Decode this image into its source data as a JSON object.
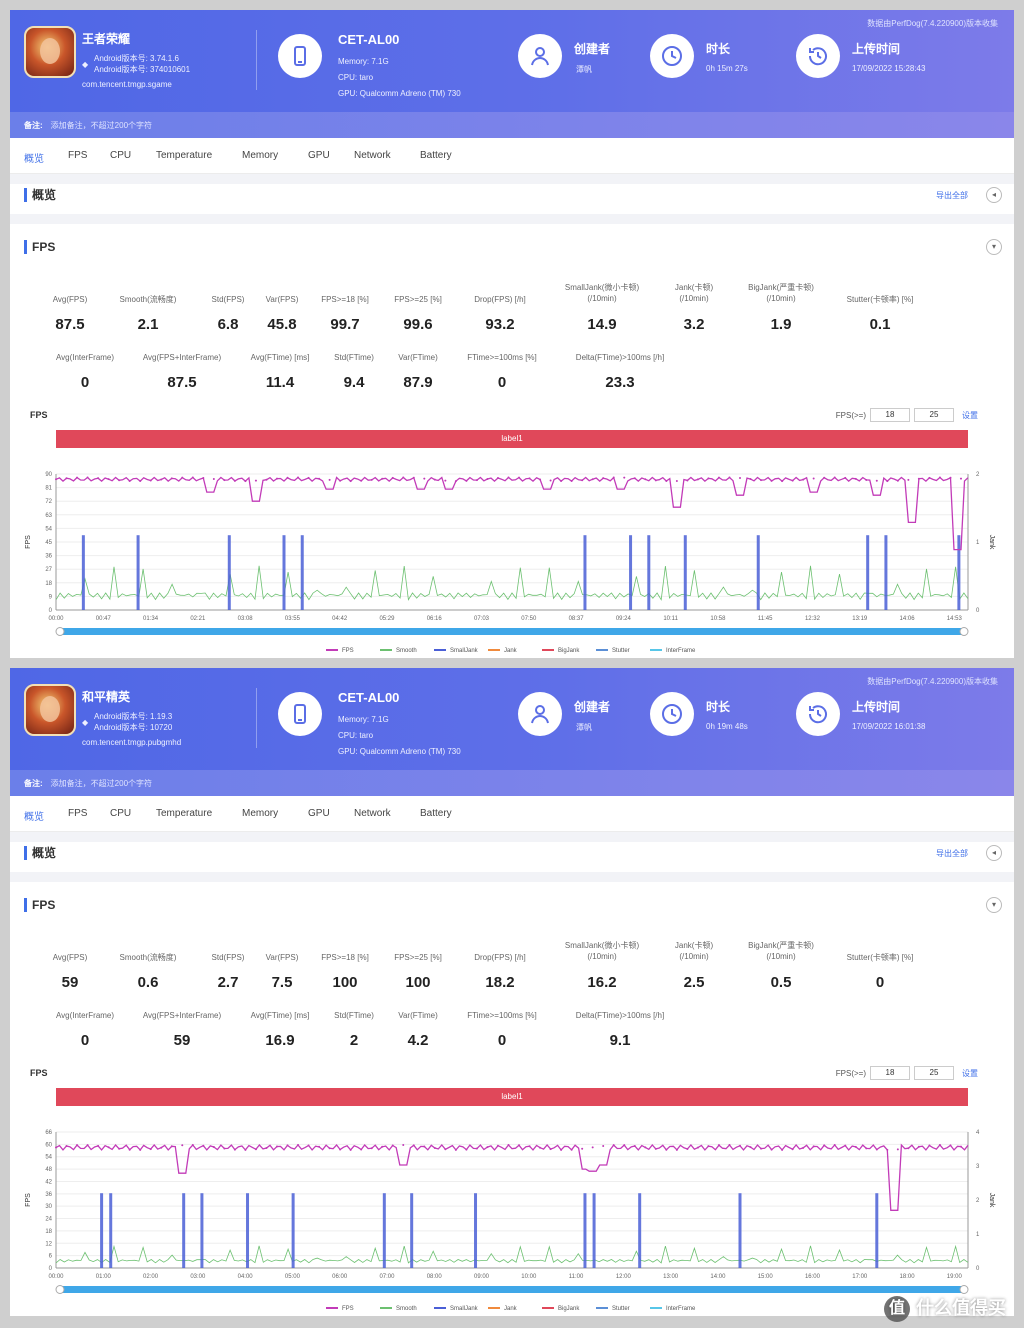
{
  "reports": [
    {
      "game": {
        "name": "王者荣耀",
        "android_ver": "Android版本号: 3.74.1.6",
        "android_code": "Android版本号: 374010601",
        "package": "com.tencent.tmgp.sgame"
      },
      "device": {
        "name": "CET-AL00",
        "memory": "Memory: 7.1G",
        "cpu": "CPU: taro",
        "gpu": "GPU: Qualcomm Adreno (TM) 730"
      },
      "creator": {
        "label": "创建者",
        "value": "潭帆"
      },
      "duration": {
        "label": "时长",
        "value": "0h 15m 27s"
      },
      "upload": {
        "label": "上传时间",
        "value": "17/09/2022 15:28:43"
      },
      "source": "数据由PerfDog(7.4.220900)版本收集",
      "note": {
        "label": "备注:",
        "placeholder": "添加备注，不超过200个字符"
      },
      "tabs": [
        "概览",
        "FPS",
        "CPU",
        "Temperature",
        "Memory",
        "GPU",
        "Network",
        "Battery"
      ],
      "overview_title": "概览",
      "export_label": "导出全部",
      "fps_title": "FPS",
      "metrics_row1": [
        {
          "name": "Avg(FPS)",
          "value": "87.5"
        },
        {
          "name": "Smooth(流畅度)",
          "value": "2.1"
        },
        {
          "name": "Std(FPS)",
          "value": "6.8"
        },
        {
          "name": "Var(FPS)",
          "value": "45.8"
        },
        {
          "name": "FPS>=18 [%]",
          "value": "99.7"
        },
        {
          "name": "FPS>=25 [%]",
          "value": "99.6"
        },
        {
          "name": "Drop(FPS) [/h]",
          "value": "93.2"
        },
        {
          "name": "SmallJank(微小卡顿)\n(/10min)",
          "value": "14.9"
        },
        {
          "name": "Jank(卡顿)\n(/10min)",
          "value": "3.2"
        },
        {
          "name": "BigJank(严重卡顿)\n(/10min)",
          "value": "1.9"
        },
        {
          "name": "Stutter(卡顿率) [%]",
          "value": "0.1"
        }
      ],
      "metrics_row2": [
        {
          "name": "Avg(InterFrame)",
          "value": "0"
        },
        {
          "name": "Avg(FPS+InterFrame)",
          "value": "87.5"
        },
        {
          "name": "Avg(FTime) [ms]",
          "value": "11.4"
        },
        {
          "name": "Std(FTime)",
          "value": "9.4"
        },
        {
          "name": "Var(FTime)",
          "value": "87.9"
        },
        {
          "name": "FTime>=100ms [%]",
          "value": "0"
        },
        {
          "name": "Delta(FTime)>100ms [/h]",
          "value": "23.3"
        }
      ],
      "chart_label": "FPS",
      "threshold_label": "FPS(>=)",
      "threshold_1": "18",
      "threshold_2": "25",
      "threshold_ok": "设置",
      "label_bar": "label1",
      "chart_data": {
        "type": "line",
        "ylabel": "FPS",
        "y2label": "Jank",
        "y_ticks": [
          0,
          9,
          18,
          27,
          36,
          45,
          54,
          63,
          72,
          81,
          90
        ],
        "y2_ticks": [
          0,
          1,
          2
        ],
        "x_ticks": [
          "00:00",
          "00:47",
          "01:34",
          "02:21",
          "03:08",
          "03:55",
          "04:42",
          "05:29",
          "06:16",
          "07:03",
          "07:50",
          "08:37",
          "09:24",
          "10:11",
          "10:58",
          "11:45",
          "12:32",
          "13:19",
          "14:06",
          "14:53"
        ],
        "fps_baseline": 88,
        "fps_dips": [
          [
            0.17,
            78
          ],
          [
            0.22,
            72
          ],
          [
            0.3,
            80
          ],
          [
            0.4,
            80
          ],
          [
            0.43,
            80
          ],
          [
            0.54,
            80
          ],
          [
            0.62,
            80
          ],
          [
            0.68,
            68
          ],
          [
            0.75,
            76
          ],
          [
            0.83,
            78
          ],
          [
            0.9,
            76
          ],
          [
            0.94,
            58
          ],
          [
            0.99,
            40
          ]
        ],
        "jank_spikes": [
          0.03,
          0.09,
          0.19,
          0.25,
          0.27,
          0.58,
          0.63,
          0.65,
          0.69,
          0.77,
          0.89,
          0.91,
          0.99
        ],
        "series": [
          "FPS",
          "Smooth",
          "SmallJank",
          "Jank",
          "BigJank",
          "Stutter",
          "InterFrame"
        ]
      }
    },
    {
      "game": {
        "name": "和平精英",
        "android_ver": "Android版本号: 1.19.3",
        "android_code": "Android版本号: 10720",
        "package": "com.tencent.tmgp.pubgmhd"
      },
      "device": {
        "name": "CET-AL00",
        "memory": "Memory: 7.1G",
        "cpu": "CPU: taro",
        "gpu": "GPU: Qualcomm Adreno (TM) 730"
      },
      "creator": {
        "label": "创建者",
        "value": "潭帆"
      },
      "duration": {
        "label": "时长",
        "value": "0h 19m 48s"
      },
      "upload": {
        "label": "上传时间",
        "value": "17/09/2022 16:01:38"
      },
      "source": "数据由PerfDog(7.4.220900)版本收集",
      "note": {
        "label": "备注:",
        "placeholder": "添加备注，不超过200个字符"
      },
      "tabs": [
        "概览",
        "FPS",
        "CPU",
        "Temperature",
        "Memory",
        "GPU",
        "Network",
        "Battery"
      ],
      "overview_title": "概览",
      "export_label": "导出全部",
      "fps_title": "FPS",
      "metrics_row1": [
        {
          "name": "Avg(FPS)",
          "value": "59"
        },
        {
          "name": "Smooth(流畅度)",
          "value": "0.6"
        },
        {
          "name": "Std(FPS)",
          "value": "2.7"
        },
        {
          "name": "Var(FPS)",
          "value": "7.5"
        },
        {
          "name": "FPS>=18 [%]",
          "value": "100"
        },
        {
          "name": "FPS>=25 [%]",
          "value": "100"
        },
        {
          "name": "Drop(FPS) [/h]",
          "value": "18.2"
        },
        {
          "name": "SmallJank(微小卡顿)\n(/10min)",
          "value": "16.2"
        },
        {
          "name": "Jank(卡顿)\n(/10min)",
          "value": "2.5"
        },
        {
          "name": "BigJank(严重卡顿)\n(/10min)",
          "value": "0.5"
        },
        {
          "name": "Stutter(卡顿率) [%]",
          "value": "0"
        }
      ],
      "metrics_row2": [
        {
          "name": "Avg(InterFrame)",
          "value": "0"
        },
        {
          "name": "Avg(FPS+InterFrame)",
          "value": "59"
        },
        {
          "name": "Avg(FTime) [ms]",
          "value": "16.9"
        },
        {
          "name": "Std(FTime)",
          "value": "2"
        },
        {
          "name": "Var(FTime)",
          "value": "4.2"
        },
        {
          "name": "FTime>=100ms [%]",
          "value": "0"
        },
        {
          "name": "Delta(FTime)>100ms [/h]",
          "value": "9.1"
        }
      ],
      "chart_label": "FPS",
      "threshold_label": "FPS(>=)",
      "threshold_1": "18",
      "threshold_2": "25",
      "threshold_ok": "设置",
      "label_bar": "label1",
      "chart_data": {
        "type": "line",
        "ylabel": "FPS",
        "y2label": "Jank",
        "y_ticks": [
          0,
          6,
          12,
          18,
          24,
          30,
          36,
          42,
          48,
          54,
          60,
          66
        ],
        "y2_ticks": [
          0,
          1,
          2,
          3,
          4
        ],
        "x_ticks": [
          "00:00",
          "01:00",
          "02:00",
          "03:00",
          "04:00",
          "05:00",
          "06:00",
          "07:00",
          "08:00",
          "09:00",
          "10:00",
          "11:00",
          "12:00",
          "13:00",
          "14:00",
          "15:00",
          "16:00",
          "17:00",
          "18:00",
          "19:00"
        ],
        "fps_baseline": 60,
        "fps_dips": [
          [
            0.14,
            46
          ],
          [
            0.38,
            50
          ],
          [
            0.58,
            48
          ],
          [
            0.59,
            47
          ],
          [
            0.6,
            50
          ],
          [
            0.92,
            28
          ]
        ],
        "jank_spikes": [
          0.05,
          0.06,
          0.14,
          0.16,
          0.21,
          0.26,
          0.36,
          0.39,
          0.46,
          0.58,
          0.59,
          0.64,
          0.75,
          0.9
        ],
        "series": [
          "FPS",
          "Smooth",
          "SmallJank",
          "Jank",
          "BigJank",
          "Stutter",
          "InterFrame"
        ]
      }
    }
  ],
  "watermark": "什么值得买",
  "watermark_icon": "值"
}
